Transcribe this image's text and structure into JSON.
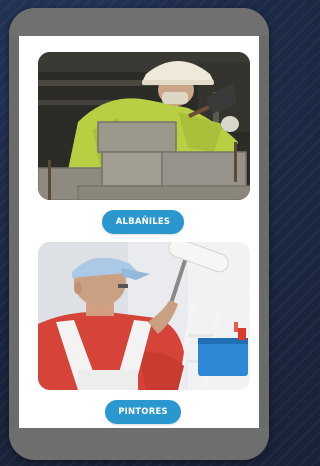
{
  "services": [
    {
      "id": "albaniles",
      "button_label": "ALBAÑILES",
      "image_subject": "mason laying concrete blocks"
    },
    {
      "id": "pintores",
      "button_label": "PINTORES",
      "image_subject": "painter holding paint roller"
    }
  ],
  "colors": {
    "button_background": "#2a97cf",
    "button_text": "#ffffff",
    "phone_frame": "#6b6b6b",
    "page_background": "#1d2a44",
    "screen_background": "#ffffff"
  }
}
